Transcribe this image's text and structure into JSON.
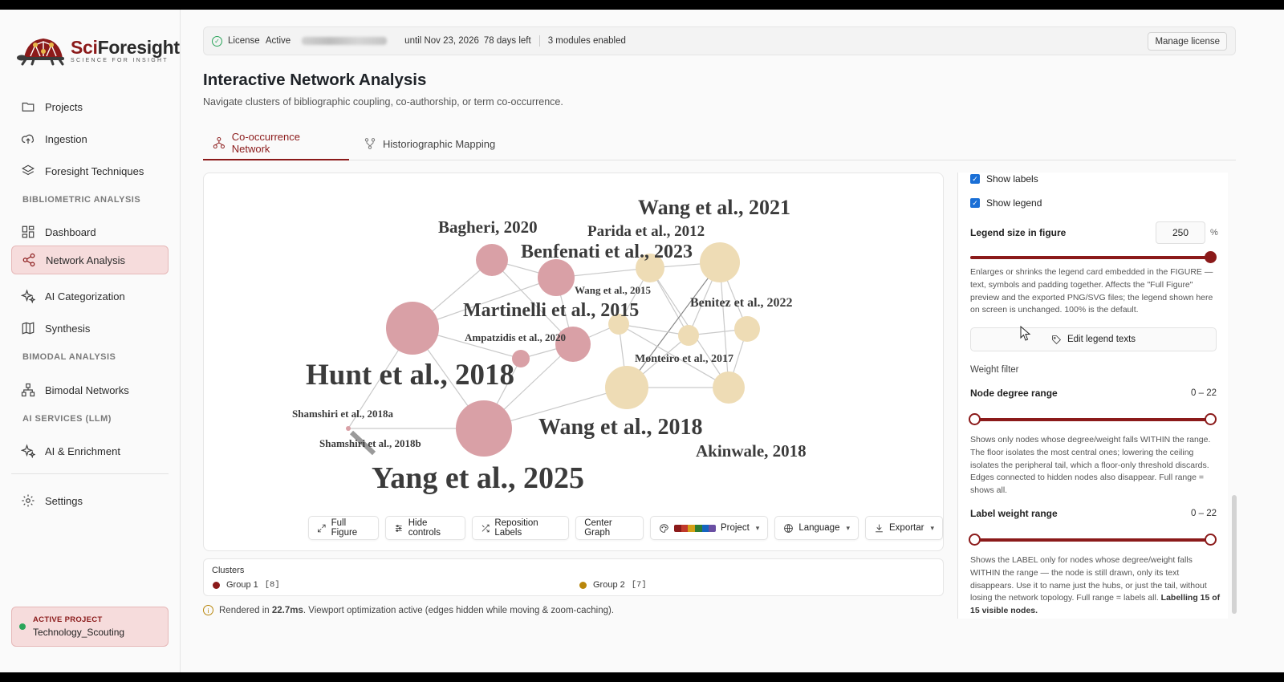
{
  "app": {
    "brand": "SciForesight",
    "brand_prefix": "Sci",
    "brand_suffix": "Foresight",
    "tagline": "SCIENCE FOR INSIGHT"
  },
  "sidebar": {
    "items": [
      {
        "label": "Projects",
        "icon": "folder-icon"
      },
      {
        "label": "Ingestion",
        "icon": "cloud-upload-icon"
      },
      {
        "label": "Foresight Techniques",
        "icon": "layers-icon"
      },
      {
        "label": "Dashboard",
        "icon": "grid-icon"
      },
      {
        "label": "Network Analysis",
        "icon": "share-icon",
        "active": true
      },
      {
        "label": "AI Categorization",
        "icon": "sparkles-icon"
      },
      {
        "label": "Synthesis",
        "icon": "book-icon"
      },
      {
        "label": "Bimodal Networks",
        "icon": "network-icon"
      },
      {
        "label": "AI & Enrichment",
        "icon": "sparkles-icon"
      },
      {
        "label": "Settings",
        "icon": "gear-icon"
      }
    ],
    "sections": [
      "BIBLIOMETRIC ANALYSIS",
      "BIMODAL ANALYSIS",
      "AI SERVICES (LLM)"
    ],
    "active_project_label": "ACTIVE PROJECT",
    "active_project_name": "Technology_Scouting"
  },
  "license": {
    "label": "License",
    "status": "Active",
    "until": "until Nov 23, 2026",
    "days_left": "78 days left",
    "modules": "3 modules enabled",
    "manage": "Manage license"
  },
  "page": {
    "title": "Interactive Network Analysis",
    "subtitle": "Navigate clusters of bibliographic coupling, co-authorship, or term co-occurrence."
  },
  "tabs": [
    {
      "label": "Co-occurrence Network",
      "active": true
    },
    {
      "label": "Historiographic Mapping",
      "active": false
    }
  ],
  "network": {
    "colors": {
      "group1": "#d9a0a6",
      "group2": "#eedcb5",
      "edge": "#c8c8c8"
    },
    "nodes": [
      {
        "label": "Bagheri, 2020",
        "group": 1
      },
      {
        "label": "Benfenati et al., 2023",
        "group": 1
      },
      {
        "label": "Martinelli et al., 2015",
        "group": 1
      },
      {
        "label": "Ampatzidis et al., 2020",
        "group": 1
      },
      {
        "label": "Hunt et al., 2018",
        "group": 1
      },
      {
        "label": "Shamshiri et al., 2018a",
        "group": 1
      },
      {
        "label": "Shamshiri et al., 2018b",
        "group": 1
      },
      {
        "label": "Yang et al., 2025",
        "group": 1
      },
      {
        "label": "Wang et al., 2021",
        "group": 2
      },
      {
        "label": "Parida et al., 2012",
        "group": 2
      },
      {
        "label": "Wang et al., 2015",
        "group": 2
      },
      {
        "label": "Benitez et al., 2022",
        "group": 2
      },
      {
        "label": "Monteiro et al., 2017",
        "group": 2
      },
      {
        "label": "Wang et al., 2018",
        "group": 2
      },
      {
        "label": "Akinwale, 2018",
        "group": 2
      }
    ]
  },
  "toolbar": {
    "full_figure": "Full Figure",
    "hide_controls": "Hide controls",
    "reposition": "Reposition Labels",
    "center": "Center Graph",
    "palette": "Project",
    "palette_colors": [
      "#8b1a1a",
      "#c0392b",
      "#d4a017",
      "#2e7d32",
      "#1565c0",
      "#6a4fa3"
    ],
    "language": "Language",
    "export": "Exportar"
  },
  "clusters": {
    "title": "Clusters",
    "items": [
      {
        "label": "Group 1",
        "count": "[8]",
        "color": "#8b1a1a"
      },
      {
        "label": "Group 2",
        "count": "[7]",
        "color": "#b8860b"
      }
    ]
  },
  "render_note": {
    "prefix": "Rendered in",
    "time": "22.7ms",
    "suffix": ". Viewport optimization active (edges hidden while moving & zoom-caching)."
  },
  "settings": {
    "show_labels": "Show labels",
    "show_legend": "Show legend",
    "legend_size_label": "Legend size in figure",
    "legend_size_value": "250",
    "legend_size_unit": "%",
    "legend_size_fraction": 1.0,
    "legend_help": "Enlarges or shrinks the legend card embedded in the FIGURE — text, symbols and padding together. Affects the \"Full Figure\" preview and the exported PNG/SVG files; the legend shown here on screen is unchanged. 100% is the default.",
    "edit_legend": "Edit legend texts",
    "weight_filter": "Weight filter",
    "node_degree_label": "Node degree range",
    "node_degree_value": "0 – 22",
    "node_degree_help": "Shows only nodes whose degree/weight falls WITHIN the range. The floor isolates the most central ones; lowering the ceiling isolates the peripheral tail, which a floor-only threshold discards. Edges connected to hidden nodes also disappear. Full range = shows all.",
    "label_weight_label": "Label weight range",
    "label_weight_value": "0 – 22",
    "label_weight_help": "Shows the LABEL only for nodes whose degree/weight falls WITHIN the range — the node is still drawn, only its text disappears. Use it to name just the hubs, or just the tail, without losing the network topology. Full range = labels all.",
    "label_weight_summary": "Labelling 15 of 15 visible nodes."
  }
}
